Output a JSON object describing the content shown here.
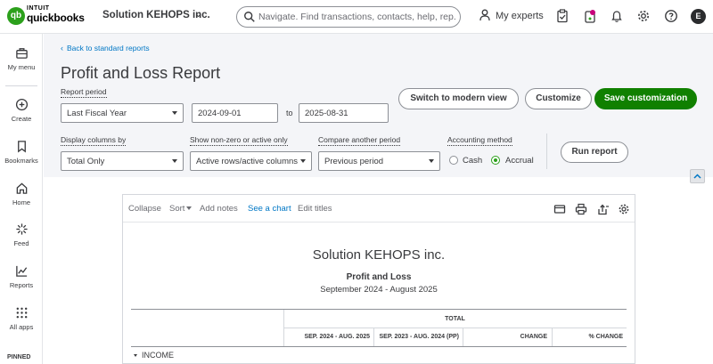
{
  "app": {
    "brand_top": "INTUIT",
    "brand_main": "quickbooks",
    "logo_mark": "qb",
    "company_name": "Solution KEHOPS inc."
  },
  "topbar": {
    "search_placeholder": "Navigate. Find transactions, contacts, help, rep...",
    "my_experts": "My experts",
    "avatar_initial": "E",
    "icons": [
      "search-icon",
      "person-icon",
      "clipboard-icon",
      "apps-notification-icon",
      "bell-icon",
      "gear-icon",
      "help-icon"
    ]
  },
  "leftnav": {
    "items": [
      {
        "label": "My menu",
        "icon": "briefcase-icon"
      },
      {
        "label": "Create",
        "icon": "plus-circle-icon"
      },
      {
        "label": "Bookmarks",
        "icon": "bookmark-icon"
      },
      {
        "label": "Home",
        "icon": "home-icon"
      },
      {
        "label": "Feed",
        "icon": "feed-icon"
      },
      {
        "label": "Reports",
        "icon": "reports-icon"
      },
      {
        "label": "All apps",
        "icon": "grid-icon"
      }
    ],
    "pinned_label": "PINNED"
  },
  "header": {
    "back_link": "Back to standard reports",
    "title": "Profit and Loss Report",
    "report_period_label": "Report period",
    "report_period_value": "Last Fiscal Year",
    "date_from": "2024-09-01",
    "date_to_label": "to",
    "date_to": "2025-08-31",
    "switch_button": "Switch to modern view",
    "customize_button": "Customize",
    "save_button": "Save customization",
    "display_columns_label": "Display columns by",
    "display_columns_value": "Total Only",
    "show_nonzero_label": "Show non-zero or active only",
    "show_nonzero_value": "Active rows/active columns",
    "compare_label": "Compare another period",
    "compare_value": "Previous period",
    "accounting_method_label": "Accounting method",
    "cash_label": "Cash",
    "accrual_label": "Accrual",
    "accounting_method_selected": "Accrual",
    "run_report_button": "Run report"
  },
  "report": {
    "toolbar": {
      "collapse": "Collapse",
      "sort": "Sort",
      "add_notes": "Add notes",
      "see_chart": "See a chart",
      "edit_titles": "Edit titles"
    },
    "toolbar_icons": [
      "email-icon",
      "print-icon",
      "export-icon",
      "settings-icon"
    ],
    "company": "Solution KEHOPS inc.",
    "name": "Profit and Loss",
    "range": "September 2024 - August 2025",
    "table": {
      "group_header": "TOTAL",
      "columns": [
        "SEP. 2024 - AUG. 2025",
        "SEP. 2023 - AUG. 2024 (PP)",
        "CHANGE",
        "% CHANGE"
      ],
      "rows": [
        {
          "label": "INCOME"
        }
      ]
    }
  },
  "colors": {
    "brand_green": "#2ca01c",
    "button_green": "#108000",
    "link_blue": "#0077c5",
    "text": "#393a3d",
    "header_bg": "#f4f5f8"
  }
}
